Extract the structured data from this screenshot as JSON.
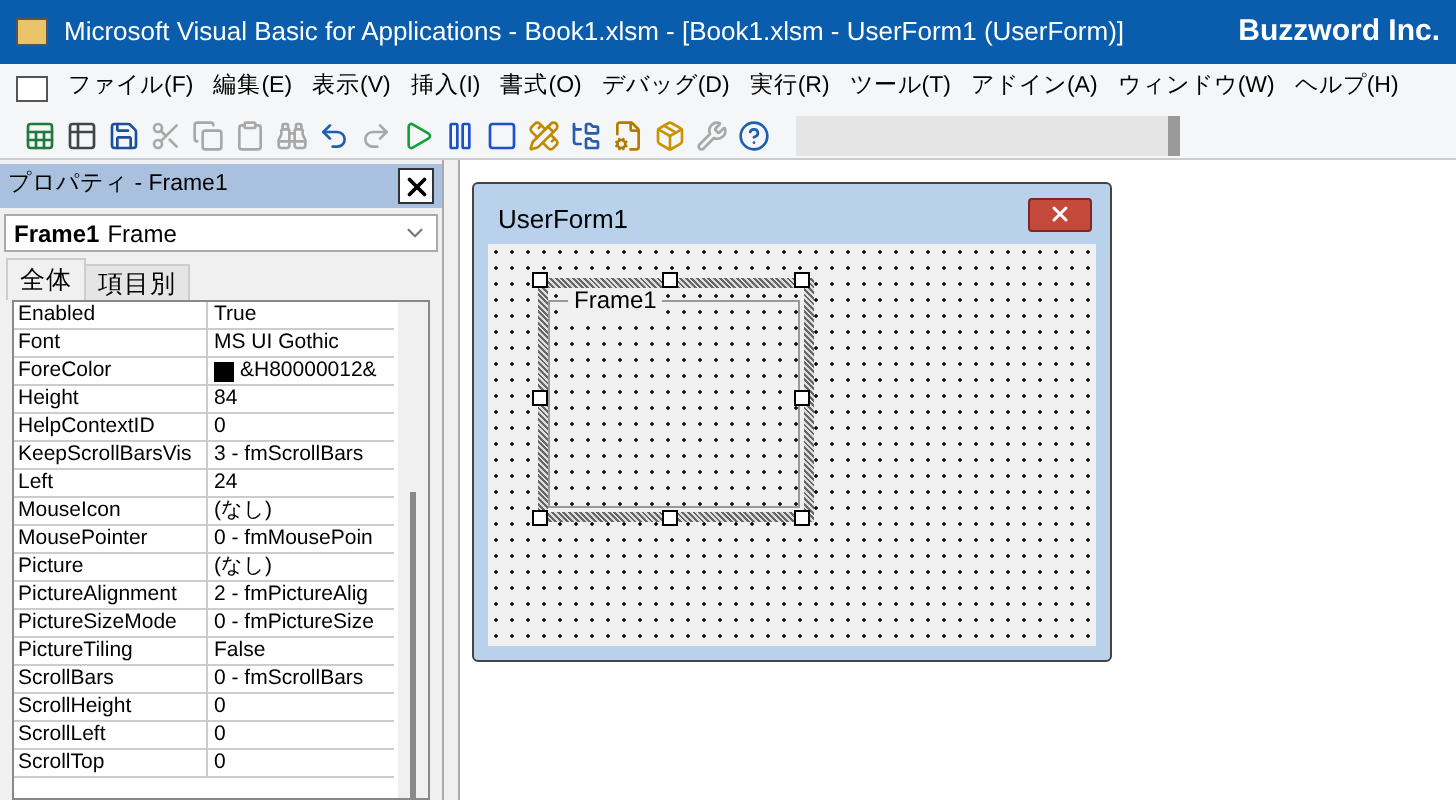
{
  "window": {
    "title": "Microsoft Visual Basic for Applications - Book1.xlsm - [Book1.xlsm - UserForm1 (UserForm)]",
    "brand": "Buzzword Inc."
  },
  "menu": [
    "ファイル(F)",
    "編集(E)",
    "表示(V)",
    "挿入(I)",
    "書式(O)",
    "デバッグ(D)",
    "実行(R)",
    "ツール(T)",
    "アドイン(A)",
    "ウィンドウ(W)",
    "ヘルプ(H)"
  ],
  "toolbar": [
    {
      "kind": "excel",
      "disabled": false
    },
    {
      "kind": "insert",
      "disabled": false
    },
    {
      "kind": "save",
      "disabled": false
    },
    {
      "kind": "cut",
      "disabled": true
    },
    {
      "kind": "copy",
      "disabled": true
    },
    {
      "kind": "paste",
      "disabled": true
    },
    {
      "kind": "find",
      "disabled": true
    },
    {
      "kind": "undo",
      "disabled": false
    },
    {
      "kind": "redo",
      "disabled": true
    },
    {
      "kind": "run",
      "disabled": false
    },
    {
      "kind": "pause",
      "disabled": false
    },
    {
      "kind": "stop",
      "disabled": false
    },
    {
      "kind": "design",
      "disabled": false
    },
    {
      "kind": "project",
      "disabled": false
    },
    {
      "kind": "properties",
      "disabled": false
    },
    {
      "kind": "browser",
      "disabled": false
    },
    {
      "kind": "toolbox",
      "disabled": true
    },
    {
      "kind": "help",
      "disabled": false
    }
  ],
  "properties": {
    "title": "プロパティ - Frame1",
    "object_name": "Frame1",
    "object_type": "Frame",
    "tabs": [
      {
        "label": "全体",
        "selected": true
      },
      {
        "label": "項目別",
        "selected": false
      }
    ],
    "rows": [
      {
        "name": "Enabled",
        "value": "True"
      },
      {
        "name": "Font",
        "value": "MS UI Gothic"
      },
      {
        "name": "ForeColor",
        "value": "&H80000012&",
        "color": "#000000"
      },
      {
        "name": "Height",
        "value": "84"
      },
      {
        "name": "HelpContextID",
        "value": "0"
      },
      {
        "name": "KeepScrollBarsVis",
        "value": "3 - fmScrollBars"
      },
      {
        "name": "Left",
        "value": "24"
      },
      {
        "name": "MouseIcon",
        "value": "(なし)"
      },
      {
        "name": "MousePointer",
        "value": "0 - fmMousePoin"
      },
      {
        "name": "Picture",
        "value": "(なし)"
      },
      {
        "name": "PictureAlignment",
        "value": "2 - fmPictureAlig"
      },
      {
        "name": "PictureSizeMode",
        "value": "0 - fmPictureSize"
      },
      {
        "name": "PictureTiling",
        "value": "False"
      },
      {
        "name": "ScrollBars",
        "value": "0 - fmScrollBars"
      },
      {
        "name": "ScrollHeight",
        "value": "0"
      },
      {
        "name": "ScrollLeft",
        "value": "0"
      },
      {
        "name": "ScrollTop",
        "value": "0"
      }
    ]
  },
  "userform": {
    "title": "UserForm1",
    "frame": {
      "caption": "Frame1",
      "selected": true
    }
  }
}
